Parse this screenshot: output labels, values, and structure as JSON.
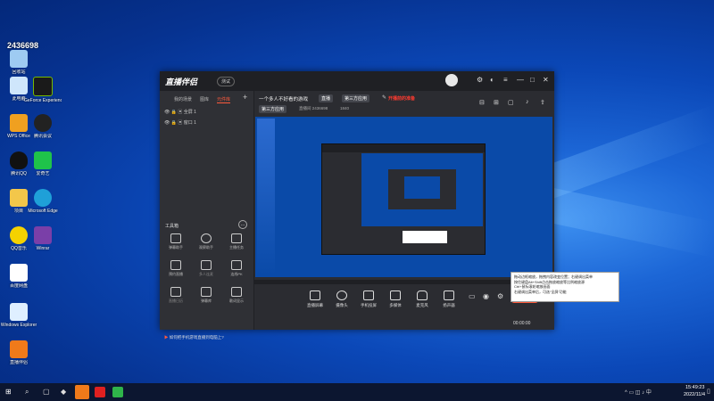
{
  "desktop": {
    "icons": [
      {
        "label": "回收站"
      },
      {
        "label": "此电脑"
      },
      {
        "label": "GeForce Experience"
      },
      {
        "label": "WPS Office"
      },
      {
        "label": "腾讯会议"
      },
      {
        "label": "腾讯QQ"
      },
      {
        "label": "爱奇艺"
      },
      {
        "label": "项目"
      },
      {
        "label": "Microsoft Edge"
      },
      {
        "label": "QQ音乐"
      },
      {
        "label": "Winrar"
      },
      {
        "label": "百度网盘"
      },
      {
        "label": "Windows Explorer"
      },
      {
        "label": "直播伴侣"
      }
    ],
    "overlay_number": "2436698"
  },
  "window": {
    "logo": "直播伴侣",
    "badge": "测试",
    "left_tabs": [
      "我的场景",
      "图库",
      "元件库"
    ],
    "sources": [
      "全屏 1",
      "窗口 1"
    ],
    "tools_title": "工具箱",
    "tools": [
      {
        "label": "弹幕助手"
      },
      {
        "label": "观察助手"
      },
      {
        "label": "主播任务"
      },
      {
        "label": "预约直播"
      },
      {
        "label": "多人连麦"
      },
      {
        "label": "连线PK"
      },
      {
        "label": "直播日历"
      },
      {
        "label": "弹幕库"
      },
      {
        "label": "歌词显示"
      }
    ],
    "notice": "如何把手机游戏直播到电脑上?",
    "room_title": "一个多人不好看的游戏",
    "room_tag": "直播",
    "category": "第三方应用",
    "room_line": "直播间 2436698",
    "likes": "1840",
    "red_text": "开播前的准备",
    "bottom_tools": [
      {
        "label": "直播屏幕"
      },
      {
        "label": "摄像头"
      },
      {
        "label": "手机投屏"
      },
      {
        "label": "多媒体"
      },
      {
        "label": "麦克风"
      },
      {
        "label": "扬声器"
      }
    ],
    "time": "00:00:00"
  },
  "tooltip": {
    "lines": [
      "拖动边框缩放，拖拽内容改变位置；右键调出菜单",
      "按住键盘Alt+Shift点击拖放缩放等比例缩放源",
      "Ctrl+鼠标滚轮缩放画面",
      "右键调出菜单后，可选“全屏”功能"
    ]
  },
  "taskbar": {
    "time": "15:49:23",
    "date": "2022/11/4"
  },
  "colors": {
    "accent": "#ff5a3c",
    "wallpaper": "#0b48b8",
    "window_bg": "#2b2c31"
  }
}
